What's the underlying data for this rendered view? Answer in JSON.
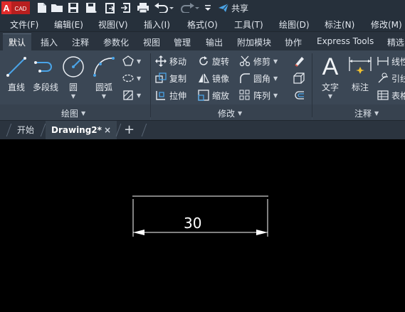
{
  "app": {
    "logo_text": "CAD",
    "logo_letter": "A"
  },
  "quick_access": {
    "share_label": "共享",
    "icons": [
      "new-file-icon",
      "open-folder-icon",
      "save-icon",
      "save-as-icon",
      "export-icon",
      "import-icon",
      "print-icon",
      "undo-icon",
      "redo-icon",
      "dropdown-icon"
    ]
  },
  "menu": {
    "items": [
      "文件(F)",
      "编辑(E)",
      "视图(V)",
      "插入(I)",
      "格式(O)",
      "工具(T)",
      "绘图(D)",
      "标注(N)",
      "修改(M)"
    ]
  },
  "ribbon_tabs": {
    "items": [
      "默认",
      "插入",
      "注释",
      "参数化",
      "视图",
      "管理",
      "输出",
      "附加模块",
      "协作",
      "Express Tools",
      "精选"
    ],
    "active": "默认"
  },
  "draw_panel": {
    "title": "绘图",
    "tools": {
      "line": "直线",
      "polyline": "多段线",
      "circle": "圆",
      "arc": "圆弧"
    }
  },
  "modify_panel": {
    "title": "修改",
    "tools": {
      "move": "移动",
      "rotate": "旋转",
      "trim": "修剪",
      "copy": "复制",
      "mirror": "镜像",
      "fillet": "圆角",
      "stretch": "拉伸",
      "scale": "缩放",
      "array": "阵列"
    }
  },
  "annotation_panel": {
    "title": "注释",
    "tools": {
      "text": "文字",
      "dimension": "标注",
      "linear": "线性",
      "leader": "引线",
      "table": "表格"
    },
    "big_letter": "A"
  },
  "doc_tabs": {
    "items": [
      "开始",
      "Drawing2*"
    ],
    "active": "Drawing2*",
    "close_glyph": "×",
    "add_glyph": "+"
  },
  "drawing": {
    "dimension_value": "30",
    "colors": {
      "background": "#000000",
      "lines": "#ffffff"
    }
  },
  "colors": {
    "chrome": "#26303b",
    "ribbon": "#3b4755",
    "accent_blue": "#4aa3e6",
    "logo_red": "#e02b2b"
  }
}
